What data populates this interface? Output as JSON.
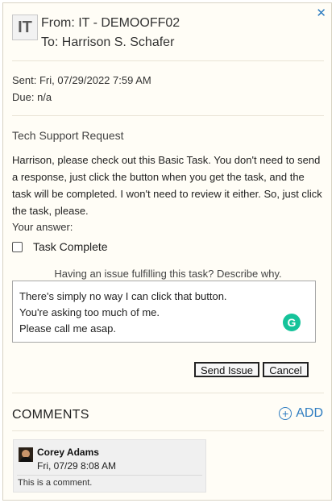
{
  "header": {
    "close_icon": "close-icon",
    "sender_avatar": "IT",
    "from": "From: IT - DEMOOFF02",
    "to": "To: Harrison S. Schafer"
  },
  "meta": {
    "sent": "Sent: Fri, 07/29/2022 7:59 AM",
    "due": "Due: n/a"
  },
  "task": {
    "title": "Tech Support Request",
    "description": "Harrison, please check out this Basic Task. You don't need to send a response, just click the button when you get the task, and the task will be completed. I won't need to review it either. So, just click the task, please.",
    "answer_label": "Your answer:",
    "checkbox_label": "Task Complete",
    "checkbox_checked": false
  },
  "issue": {
    "prompt": "Having an issue fulfilling this task? Describe why.",
    "lines": [
      "There's simply no way I can click that button.",
      "You're asking too much of me.",
      "Please call me asap."
    ],
    "grammarly_letter": "G",
    "send_label": "Send Issue",
    "cancel_label": "Cancel"
  },
  "comments": {
    "title": "COMMENTS",
    "add_label": "ADD",
    "items": [
      {
        "author": "Corey Adams",
        "time": "Fri, 07/29 8:08 AM",
        "body": "This is a comment."
      }
    ]
  },
  "colors": {
    "accent": "#2f7dc1",
    "panel_bg": "#fffdf6",
    "grammarly": "#15c39a"
  }
}
